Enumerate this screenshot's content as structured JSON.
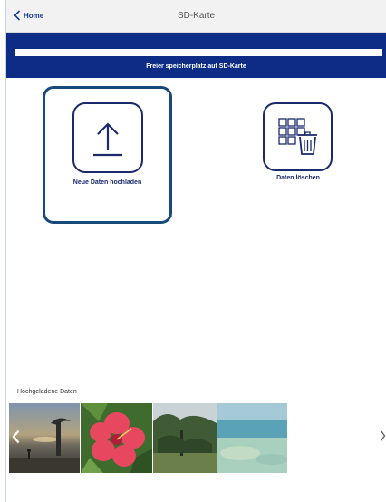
{
  "header": {
    "back_label": "Home",
    "title": "SD-Karte"
  },
  "storage": {
    "label": "Freier speicherplatz auf SD-Karte",
    "free_fraction": 1.0
  },
  "actions": {
    "upload_label": "Neue Daten hochladen",
    "delete_label": "Daten löschen"
  },
  "gallery": {
    "title": "Hochgeladene Daten",
    "items": [
      "beach-sunset-photo",
      "hibiscus-flower-photo",
      "garden-trees-photo",
      "sea-coast-photo"
    ]
  },
  "colors": {
    "accent": "#0c2c86",
    "icon_stroke": "#1a2a6c",
    "selection_border": "#174a7a"
  },
  "icons": {
    "back": "chevron-left-icon",
    "upload": "upload-icon",
    "delete": "trash-grid-icon",
    "prev": "chevron-left-icon",
    "next": "chevron-right-icon"
  }
}
